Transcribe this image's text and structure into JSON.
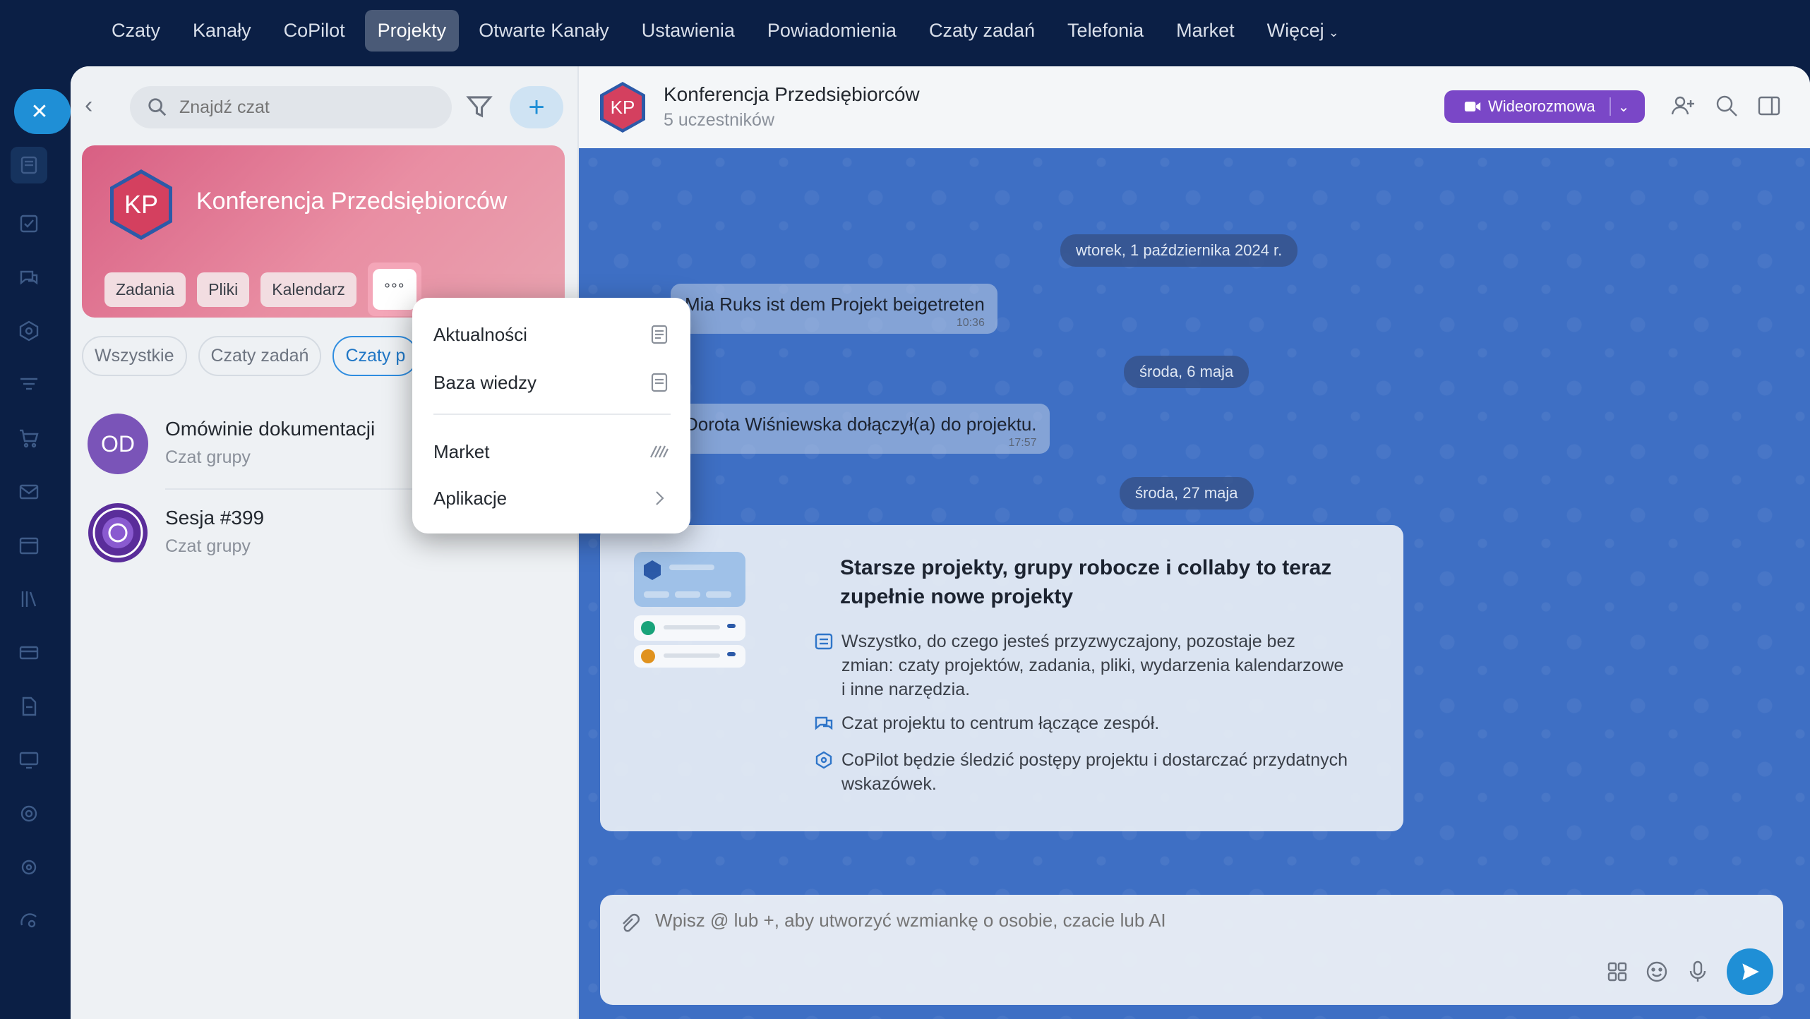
{
  "topnav": {
    "items": [
      "Czaty",
      "Kanały",
      "CoPilot",
      "Projekty",
      "Otwarte Kanały",
      "Ustawienia",
      "Powiadomienia",
      "Czaty zadań",
      "Telefonia",
      "Market",
      "Więcej"
    ],
    "active": "Projekty"
  },
  "sidebar": {
    "search_placeholder": "Znajdź czat",
    "hero": {
      "initials": "KP",
      "title": "Konferencja Przedsiębiorców",
      "chips": [
        "Zadania",
        "Pliki",
        "Kalendarz"
      ],
      "more_label": "°°°"
    },
    "filters": [
      "Wszystkie",
      "Czaty zadań",
      "Czaty p"
    ],
    "chats": [
      {
        "initials": "OD",
        "name": "Omówinie dokumentacji",
        "sub": "Czat grupy"
      },
      {
        "initials": "",
        "name": "Sesja #399",
        "sub": "Czat grupy"
      }
    ]
  },
  "header": {
    "initials": "KP",
    "title": "Konferencja Przedsiębiorców",
    "members": "5 uczestników",
    "video_label": "Wideorozmowa"
  },
  "messages": {
    "date1": "wtorek, 1 października 2024 r.",
    "msg1": {
      "text": "Mia Ruks ist dem Projekt beigetreten",
      "time": "10:36"
    },
    "date2": "środa, 6 maja",
    "msg2": {
      "text": "Dorota Wiśniewska dołączył(a) do projektu.",
      "time": "17:57"
    },
    "date3": "środa, 27 maja"
  },
  "card": {
    "title": "Starsze projekty, grupy robocze i collaby to teraz zupełnie nowe projekty",
    "items": [
      "Wszystko, do czego jesteś przyzwyczajony, pozostaje bez zmian: czaty projektów, zadania, pliki, wydarzenia kalendarzowe i inne narzędzia.",
      "Czat projektu to centrum łączące zespół.",
      "CoPilot będzie śledzić postępy projektu i dostarczać przydatnych wskazówek."
    ]
  },
  "composer": {
    "placeholder": "Wpisz @ lub +, aby utworzyć wzmiankę o osobie, czacie lub AI"
  },
  "dropdown": {
    "items": [
      "Aktualności",
      "Baza wiedzy",
      "Market",
      "Aplikacje"
    ]
  },
  "colors": {
    "accent": "#1f8fd6",
    "video": "#7a47c7",
    "hero": "#d85f83",
    "chat_bg": "#3e6fc4"
  }
}
